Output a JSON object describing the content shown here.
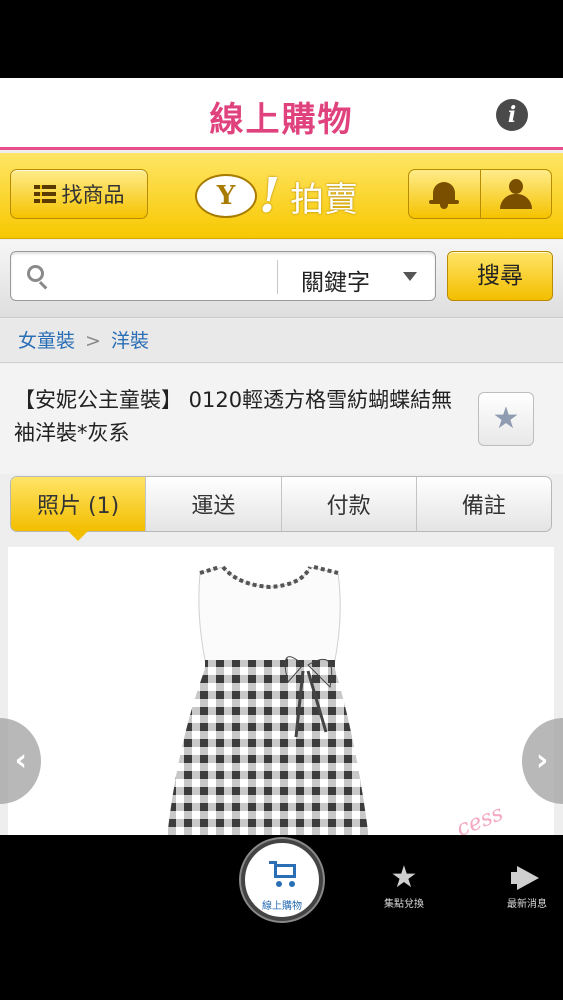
{
  "header": {
    "title": "線上購物",
    "info_icon": "info-icon"
  },
  "brand_bar": {
    "find_button": "找商品",
    "logo_letter": "Y",
    "logo_bang": "!",
    "logo_text": "拍賣",
    "icons": [
      "bell-icon",
      "user-icon"
    ]
  },
  "search": {
    "placeholder": "",
    "value": "",
    "scope_selected": "關鍵字",
    "button": "搜尋"
  },
  "breadcrumb": {
    "items": [
      "女童裝",
      "洋裝"
    ],
    "separator": ">"
  },
  "product": {
    "title": "【安妮公主童裝】 0120輕透方格雪紡蝴蝶結無袖洋裝*灰系",
    "favorite_icon": "star-icon",
    "watermark": "cess"
  },
  "tabs": [
    {
      "label": "照片 (1)",
      "active": true
    },
    {
      "label": "運送",
      "active": false
    },
    {
      "label": "付款",
      "active": false
    },
    {
      "label": "備註",
      "active": false
    }
  ],
  "bottom_nav": [
    {
      "label": "線上購物",
      "icon": "cart-icon",
      "active": true
    },
    {
      "label": "集點兌換",
      "icon": "star-icon",
      "active": false
    },
    {
      "label": "最新消息",
      "icon": "megaphone-icon",
      "active": false
    }
  ],
  "colors": {
    "accent_pink": "#e0427e",
    "brand_yellow": "#f5c200",
    "link_blue": "#2a6eb5"
  }
}
